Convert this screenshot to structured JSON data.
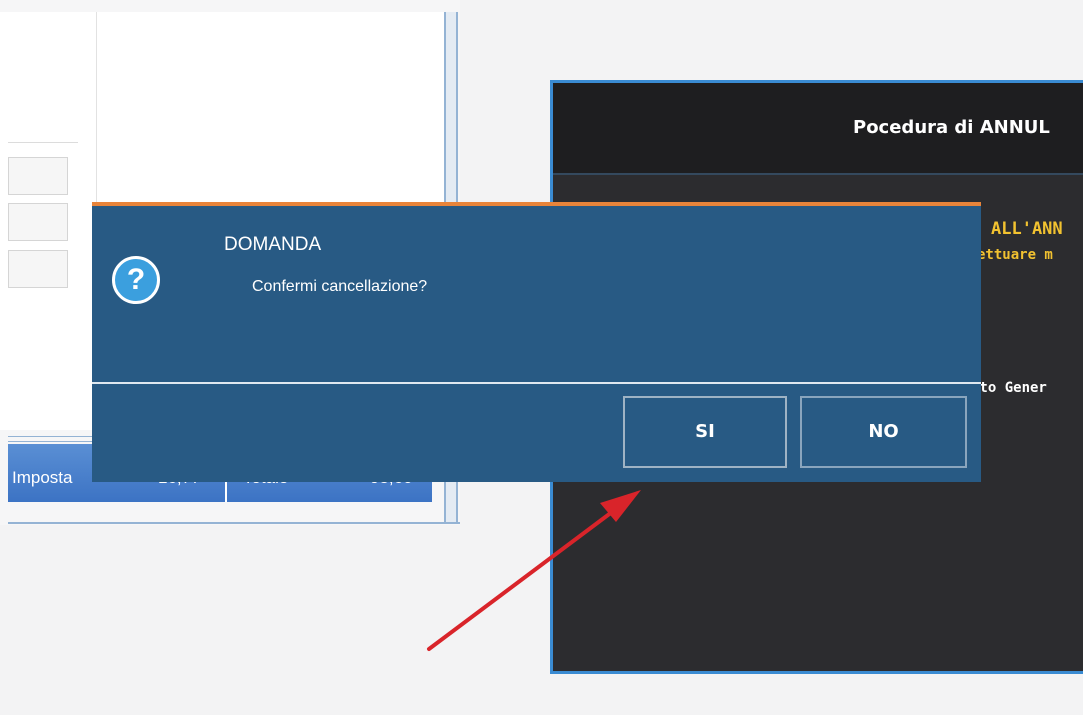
{
  "background_form": {
    "totals": [
      {
        "label": "Imposta",
        "value": "16,77"
      },
      {
        "label": "Totale",
        "value": "95,60"
      }
    ]
  },
  "dark_window": {
    "title": "Pocedura di ANNUL",
    "warning_heading": "ALL'ANN",
    "warning_subtext": "ettuare m",
    "field_label": "nto Gener"
  },
  "dialog": {
    "title": "DOMANDA",
    "message": "Confermi cancellazione?",
    "icon": "question-icon",
    "buttons": {
      "yes_label": "SI",
      "no_label": "NO"
    }
  },
  "colors": {
    "dialog_bg": "#285a84",
    "dialog_accent": "#e8843a",
    "warning_text": "#f2c230",
    "annotation_arrow": "#d9242a"
  }
}
